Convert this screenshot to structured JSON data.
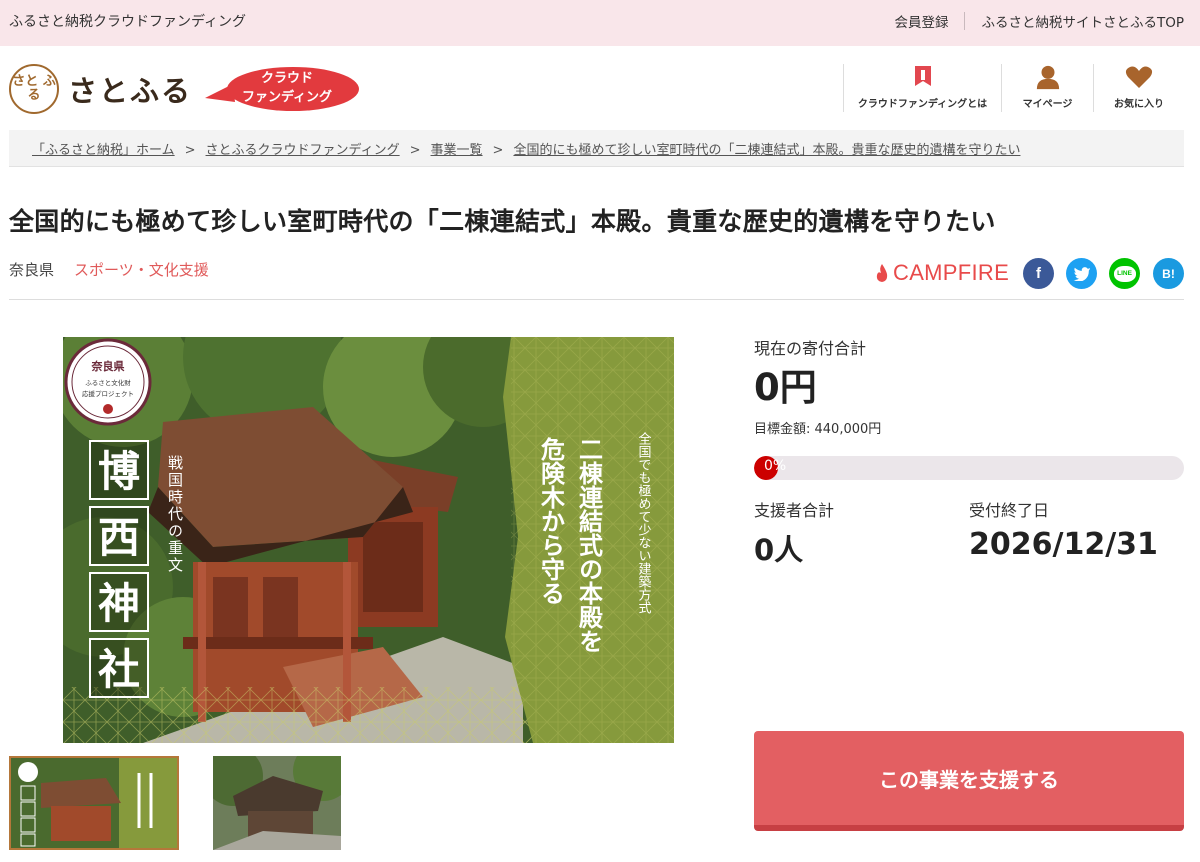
{
  "topbar": {
    "site_name": "ふるさと納税クラウドファンディング",
    "member_register": "会員登録",
    "satofull_top": "ふるさと納税サイトさとふるTOP"
  },
  "header": {
    "logo_seal": "さと ふる",
    "logo_text": "さとふる",
    "badge_line1": "クラウド",
    "badge_line2": "ファンディング",
    "nav": [
      {
        "label": "クラウドファンディングとは",
        "icon": "flag-icon"
      },
      {
        "label": "マイページ",
        "icon": "person-icon"
      },
      {
        "label": "お気に入り",
        "icon": "heart-icon"
      }
    ]
  },
  "breadcrumb": [
    "「ふるさと納税」ホーム",
    "さとふるクラウドファンディング",
    "事業一覧",
    "全国的にも極めて珍しい室町時代の「二棟連結式」本殿。貴重な歴史的遺構を守りたい"
  ],
  "project": {
    "title": "全国的にも極めて珍しい室町時代の「二棟連結式」本殿。貴重な歴史的遺構を守りたい",
    "prefecture": "奈良県",
    "category": "スポーツ・文化支援",
    "platform": "CAMPFIRE",
    "share": {
      "facebook": "f",
      "twitter": "twitter-icon",
      "line": "LINE",
      "hatena": "B!"
    }
  },
  "image": {
    "badge_pref": "奈良県",
    "badge_line1": "ふるさと文化財",
    "badge_line2": "応援プロジェクト",
    "vertical_era": "戦国時代の重文",
    "shrine_chars": [
      "博",
      "西",
      "神",
      "社"
    ],
    "right_small": "全国でも極めて少ない建築方式",
    "right_main_1": "二棟連結式の本殿を",
    "right_main_2": "危険木から守る"
  },
  "stats": {
    "current_label": "現在の寄付合計",
    "current_value": "0円",
    "target_label": "目標金額: 440,000円",
    "progress_fraction": 0.0,
    "progress_text": "0%",
    "supporters_label": "支援者合計",
    "supporters_value": "0人",
    "deadline_label": "受付終了日",
    "deadline_value": "2026/12/31"
  },
  "cta": {
    "support_label": "この事業を支援する"
  },
  "colors": {
    "topbar": "#f9e6ea",
    "accent_red": "#e05a5a",
    "button": "#e35f62",
    "progress_fill": "#cc0000",
    "brand_brown": "#a0692e"
  }
}
